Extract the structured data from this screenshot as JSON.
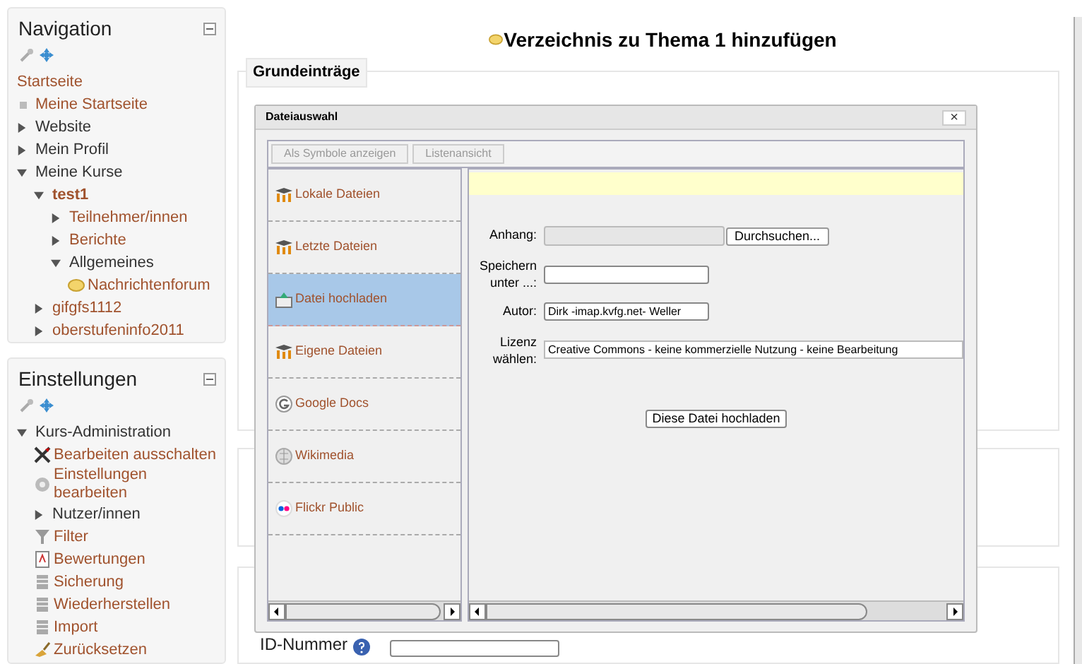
{
  "navigation": {
    "title": "Navigation",
    "items": [
      {
        "label": "Startseite",
        "kind": "plain",
        "link": true
      },
      {
        "label": "Meine Startseite",
        "kind": "bullet",
        "link": true
      },
      {
        "label": "Website",
        "kind": "branch",
        "expanded": false,
        "link": false
      },
      {
        "label": "Mein Profil",
        "kind": "branch",
        "expanded": false,
        "link": false
      },
      {
        "label": "Meine Kurse",
        "kind": "branch",
        "expanded": true,
        "link": false,
        "children": [
          {
            "label": "test1",
            "kind": "branch",
            "expanded": true,
            "link": true,
            "bold": true,
            "children": [
              {
                "label": "Teilnehmer/innen",
                "kind": "branch",
                "expanded": false,
                "link": true
              },
              {
                "label": "Berichte",
                "kind": "branch",
                "expanded": false,
                "link": true
              },
              {
                "label": "Allgemeines",
                "kind": "branch",
                "expanded": true,
                "link": false,
                "children": [
                  {
                    "label": "Nachrichtenforum",
                    "kind": "forum",
                    "link": true
                  }
                ]
              }
            ]
          },
          {
            "label": "gifgfs1112",
            "kind": "branch",
            "expanded": false,
            "link": true
          },
          {
            "label": "oberstufeninfo2011",
            "kind": "branch",
            "expanded": false,
            "link": true
          }
        ]
      }
    ]
  },
  "settings": {
    "title": "Einstellungen",
    "items": [
      {
        "label": "Kurs-Administration",
        "kind": "branch",
        "expanded": true,
        "link": false,
        "children": [
          {
            "label": "Bearbeiten ausschalten",
            "kind": "tools",
            "link": true
          },
          {
            "label": "Einstellungen bearbeiten",
            "kind": "gear",
            "link": true
          },
          {
            "label": "Nutzer/innen",
            "kind": "branch",
            "expanded": false,
            "link": false
          },
          {
            "label": "Filter",
            "kind": "filter",
            "link": true
          },
          {
            "label": "Bewertungen",
            "kind": "grades",
            "link": true
          },
          {
            "label": "Sicherung",
            "kind": "backup",
            "link": true
          },
          {
            "label": "Wiederherstellen",
            "kind": "restore",
            "link": true
          },
          {
            "label": "Import",
            "kind": "restore",
            "link": true
          },
          {
            "label": "Zurücksetzen",
            "kind": "reset",
            "link": true
          }
        ]
      }
    ]
  },
  "page_title": "Verzeichnis zu Thema 1 hinzufügen",
  "fieldset": {
    "legend": "Grundeinträge"
  },
  "id_field": {
    "label": "ID-Nummer"
  },
  "dialog": {
    "title": "Dateiauswahl",
    "close": "×",
    "view_buttons": [
      "Als Symbole anzeigen",
      "Listenansicht"
    ],
    "repositories": [
      {
        "label": "Lokale Dateien",
        "kind": "moodle",
        "selected": false
      },
      {
        "label": "Letzte Dateien",
        "kind": "moodle",
        "selected": false
      },
      {
        "label": "Datei hochladen",
        "kind": "upload",
        "selected": true
      },
      {
        "label": "Eigene Dateien",
        "kind": "moodle",
        "selected": false
      },
      {
        "label": "Google Docs",
        "kind": "google",
        "selected": false
      },
      {
        "label": "Wikimedia",
        "kind": "wiki",
        "selected": false
      },
      {
        "label": "Flickr Public",
        "kind": "flickr",
        "selected": false
      }
    ],
    "form": {
      "attachment_label": "Anhang:",
      "browse": "Durchsuchen...",
      "save_as_label": "Speichern unter ...:",
      "author_label": "Autor:",
      "author": "Dirk -imap.kvfg.net- Weller",
      "license_label": "Lizenz wählen:",
      "license": "Creative Commons - keine kommerzielle Nutzung - keine Bearbeitung",
      "upload": "Diese Datei hochladen"
    }
  }
}
